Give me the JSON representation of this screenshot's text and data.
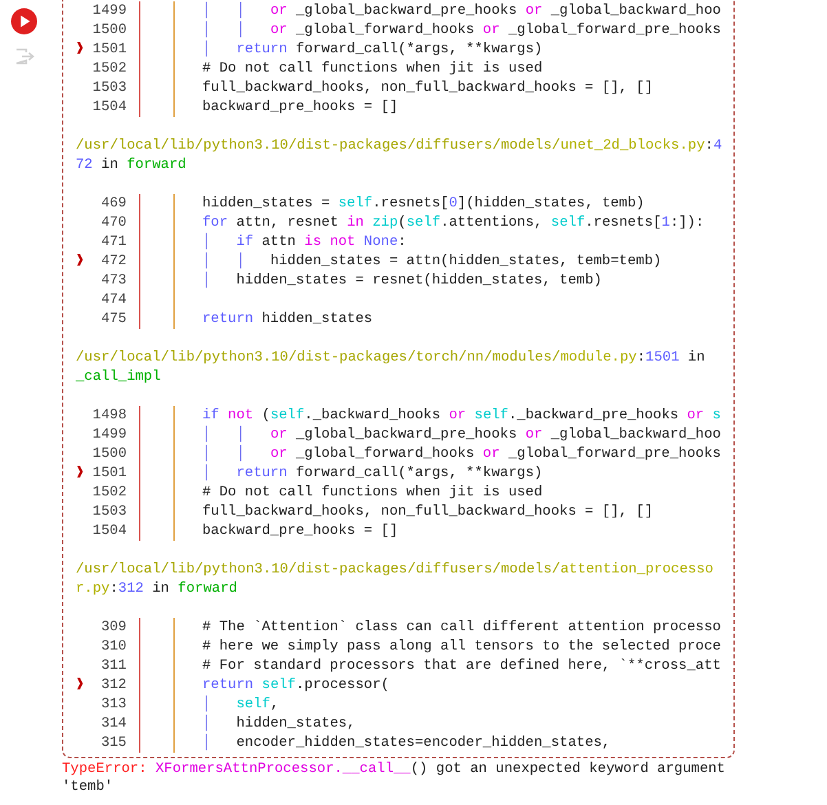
{
  "traceback": {
    "frames": [
      {
        "lines": [
          {
            "number": "1499",
            "code": [
              {
                "kind": "guide",
                "text": "│   │   "
              },
              {
                "kind": "keyword",
                "text": "or"
              },
              {
                "kind": "plain",
                "text": " _global_backward_pre_hooks "
              },
              {
                "kind": "keyword",
                "text": "or"
              },
              {
                "kind": "plain",
                "text": " _global_backward_hoo"
              }
            ]
          },
          {
            "number": "1500",
            "code": [
              {
                "kind": "guide",
                "text": "│   │   "
              },
              {
                "kind": "keyword",
                "text": "or"
              },
              {
                "kind": "plain",
                "text": " _global_forward_hooks "
              },
              {
                "kind": "keyword",
                "text": "or"
              },
              {
                "kind": "plain",
                "text": " _global_forward_pre_hooks"
              }
            ]
          },
          {
            "number": "1501",
            "marker": "❱",
            "code": [
              {
                "kind": "guide",
                "text": "│   "
              },
              {
                "kind": "control",
                "text": "return"
              },
              {
                "kind": "plain",
                "text": " forward_call(*args, **kwargs)"
              }
            ]
          },
          {
            "number": "1502",
            "code": [
              {
                "kind": "plain",
                "text": "# Do not call functions when jit is used"
              }
            ]
          },
          {
            "number": "1503",
            "code": [
              {
                "kind": "plain",
                "text": "full_backward_hooks, non_full_backward_hooks = [], []"
              }
            ]
          },
          {
            "number": "1504",
            "code": [
              {
                "kind": "plain",
                "text": "backward_pre_hooks = []"
              }
            ]
          }
        ]
      },
      {
        "location": [
          {
            "kind": "path",
            "text": "/usr/local/lib/python3.10/dist-packages/diffusers/models/"
          },
          {
            "kind": "file",
            "text": "unet_2d_blocks.py"
          },
          {
            "kind": "plain",
            "text": ":"
          },
          {
            "kind": "lineno",
            "text": "472"
          },
          {
            "kind": "plain",
            "text": " in "
          },
          {
            "kind": "function",
            "text": "forward"
          }
        ],
        "lines": [
          {
            "number": "469",
            "code": [
              {
                "kind": "plain",
                "text": "hidden_states = "
              },
              {
                "kind": "builtin",
                "text": "self"
              },
              {
                "kind": "plain",
                "text": ".resnets["
              },
              {
                "kind": "number",
                "text": "0"
              },
              {
                "kind": "plain",
                "text": "](hidden_states, temb)"
              }
            ]
          },
          {
            "number": "470",
            "code": [
              {
                "kind": "control",
                "text": "for"
              },
              {
                "kind": "plain",
                "text": " attn, resnet "
              },
              {
                "kind": "keyword",
                "text": "in "
              },
              {
                "kind": "builtin",
                "text": "zip"
              },
              {
                "kind": "plain",
                "text": "("
              },
              {
                "kind": "builtin",
                "text": "self"
              },
              {
                "kind": "plain",
                "text": ".attentions, "
              },
              {
                "kind": "builtin",
                "text": "self"
              },
              {
                "kind": "plain",
                "text": ".resnets["
              },
              {
                "kind": "number",
                "text": "1"
              },
              {
                "kind": "plain",
                "text": ":]):"
              }
            ]
          },
          {
            "number": "471",
            "code": [
              {
                "kind": "guide",
                "text": "│   "
              },
              {
                "kind": "control",
                "text": "if"
              },
              {
                "kind": "plain",
                "text": " attn "
              },
              {
                "kind": "keyword",
                "text": "is not "
              },
              {
                "kind": "control",
                "text": "None"
              },
              {
                "kind": "plain",
                "text": ":"
              }
            ]
          },
          {
            "number": "472",
            "marker": "❱",
            "code": [
              {
                "kind": "guide",
                "text": "│   │   "
              },
              {
                "kind": "plain",
                "text": "hidden_states = attn(hidden_states, temb=temb)"
              }
            ]
          },
          {
            "number": "473",
            "code": [
              {
                "kind": "guide",
                "text": "│   "
              },
              {
                "kind": "plain",
                "text": "hidden_states = resnet(hidden_states, temb)"
              }
            ]
          },
          {
            "number": "474"
          },
          {
            "number": "475",
            "code": [
              {
                "kind": "control",
                "text": "return"
              },
              {
                "kind": "plain",
                "text": " hidden_states"
              }
            ]
          }
        ]
      },
      {
        "location": [
          {
            "kind": "path",
            "text": "/usr/local/lib/python3.10/dist-packages/torch/nn/modules/"
          },
          {
            "kind": "file",
            "text": "module.py"
          },
          {
            "kind": "plain",
            "text": ":"
          },
          {
            "kind": "lineno",
            "text": "1501"
          },
          {
            "kind": "plain",
            "text": " in "
          },
          {
            "kind": "function",
            "text": "_call_impl"
          }
        ],
        "lines": [
          {
            "number": "1498",
            "code": [
              {
                "kind": "control",
                "text": "if "
              },
              {
                "kind": "keyword",
                "text": "not"
              },
              {
                "kind": "plain",
                "text": " ("
              },
              {
                "kind": "builtin",
                "text": "self"
              },
              {
                "kind": "plain",
                "text": "._backward_hooks "
              },
              {
                "kind": "keyword",
                "text": "or "
              },
              {
                "kind": "builtin",
                "text": "self"
              },
              {
                "kind": "plain",
                "text": "._backward_pre_hooks "
              },
              {
                "kind": "keyword",
                "text": "or "
              },
              {
                "kind": "builtin",
                "text": "s"
              }
            ]
          },
          {
            "number": "1499",
            "code": [
              {
                "kind": "guide",
                "text": "│   │   "
              },
              {
                "kind": "keyword",
                "text": "or"
              },
              {
                "kind": "plain",
                "text": " _global_backward_pre_hooks "
              },
              {
                "kind": "keyword",
                "text": "or"
              },
              {
                "kind": "plain",
                "text": " _global_backward_hoo"
              }
            ]
          },
          {
            "number": "1500",
            "code": [
              {
                "kind": "guide",
                "text": "│   │   "
              },
              {
                "kind": "keyword",
                "text": "or"
              },
              {
                "kind": "plain",
                "text": " _global_forward_hooks "
              },
              {
                "kind": "keyword",
                "text": "or"
              },
              {
                "kind": "plain",
                "text": " _global_forward_pre_hooks"
              }
            ]
          },
          {
            "number": "1501",
            "marker": "❱",
            "code": [
              {
                "kind": "guide",
                "text": "│   "
              },
              {
                "kind": "control",
                "text": "return"
              },
              {
                "kind": "plain",
                "text": " forward_call(*args, **kwargs)"
              }
            ]
          },
          {
            "number": "1502",
            "code": [
              {
                "kind": "plain",
                "text": "# Do not call functions when jit is used"
              }
            ]
          },
          {
            "number": "1503",
            "code": [
              {
                "kind": "plain",
                "text": "full_backward_hooks, non_full_backward_hooks = [], []"
              }
            ]
          },
          {
            "number": "1504",
            "code": [
              {
                "kind": "plain",
                "text": "backward_pre_hooks = []"
              }
            ]
          }
        ]
      },
      {
        "location": [
          {
            "kind": "path",
            "text": "/usr/local/lib/python3.10/dist-packages/diffusers/models/"
          },
          {
            "kind": "file",
            "text": "attention_processor.py"
          },
          {
            "kind": "plain",
            "text": ":"
          },
          {
            "kind": "lineno",
            "text": "312"
          },
          {
            "kind": "plain",
            "text": " in "
          },
          {
            "kind": "function",
            "text": "forward"
          }
        ],
        "lines": [
          {
            "number": "309",
            "code": [
              {
                "kind": "plain",
                "text": "# The `Attention` class can call different attention processo"
              }
            ]
          },
          {
            "number": "310",
            "code": [
              {
                "kind": "plain",
                "text": "# here we simply pass along all tensors to the selected proce"
              }
            ]
          },
          {
            "number": "311",
            "code": [
              {
                "kind": "plain",
                "text": "# For standard processors that are defined here, `**cross_att"
              }
            ]
          },
          {
            "number": "312",
            "marker": "❱",
            "code": [
              {
                "kind": "control",
                "text": "return "
              },
              {
                "kind": "builtin",
                "text": "self"
              },
              {
                "kind": "plain",
                "text": ".processor("
              }
            ]
          },
          {
            "number": "313",
            "code": [
              {
                "kind": "guide",
                "text": "│   "
              },
              {
                "kind": "builtin",
                "text": "self"
              },
              {
                "kind": "plain",
                "text": ","
              }
            ]
          },
          {
            "number": "314",
            "code": [
              {
                "kind": "guide",
                "text": "│   "
              },
              {
                "kind": "plain",
                "text": "hidden_states,"
              }
            ]
          },
          {
            "number": "315",
            "code": [
              {
                "kind": "guide",
                "text": "│   "
              },
              {
                "kind": "plain",
                "text": "encoder_hidden_states=encoder_hidden_states,"
              }
            ]
          }
        ]
      }
    ]
  },
  "error": {
    "type": "TypeError:",
    "subject": "XFormersAttnProcessor.__call__",
    "message": "() got an unexpected keyword argument 'temb'"
  }
}
